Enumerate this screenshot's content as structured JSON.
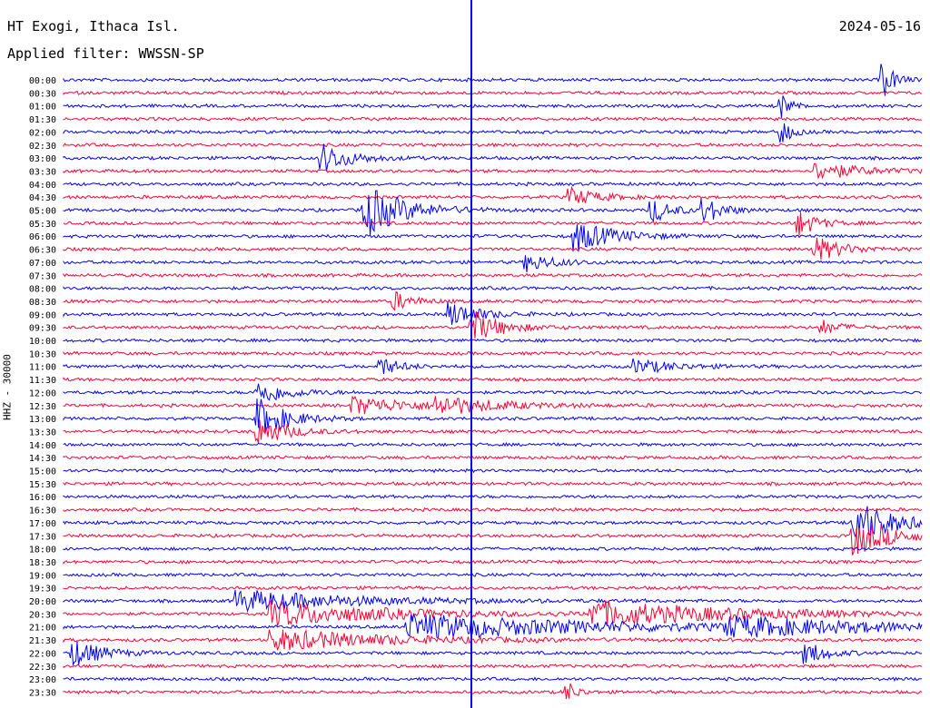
{
  "header": {
    "station": "HT Exogi, Ithaca Isl.",
    "date": "2024-05-16",
    "filter": "Applied filter: WWSSN-SP"
  },
  "chart_data": {
    "type": "line",
    "title": "HT Exogi, Ithaca Isl.",
    "subtitle": "Applied filter: WWSSN-SP",
    "ylabel": "HHZ - 30000",
    "date": "2024-05-16",
    "row_labels": [
      "00:00",
      "00:30",
      "01:00",
      "01:30",
      "02:00",
      "02:30",
      "03:00",
      "03:30",
      "04:00",
      "04:30",
      "05:00",
      "05:30",
      "06:00",
      "06:30",
      "07:00",
      "07:30",
      "08:00",
      "08:30",
      "09:00",
      "09:30",
      "10:00",
      "10:30",
      "11:00",
      "11:30",
      "12:00",
      "12:30",
      "13:00",
      "13:30",
      "14:00",
      "14:30",
      "15:00",
      "15:30",
      "16:00",
      "16:30",
      "17:00",
      "17:30",
      "18:00",
      "18:30",
      "19:00",
      "19:30",
      "20:00",
      "20:30",
      "21:00",
      "21:30",
      "22:00",
      "22:30",
      "23:00",
      "23:30"
    ],
    "colors": [
      "#0000ff",
      "#ff0033"
    ]
  }
}
